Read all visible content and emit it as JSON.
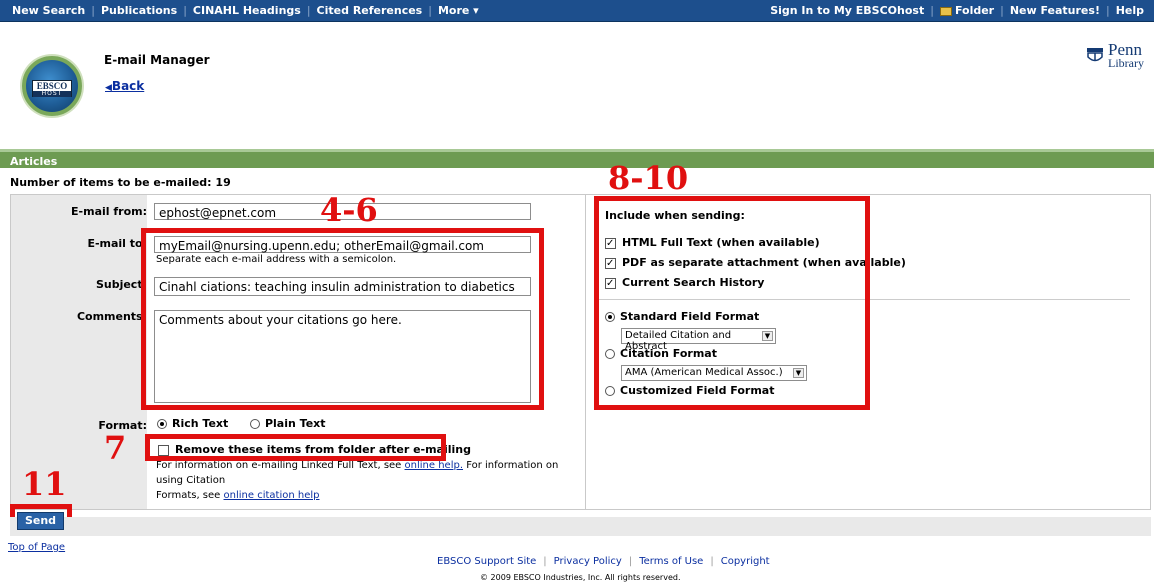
{
  "nav": {
    "left": [
      "New Search",
      "Publications",
      "CINAHL Headings",
      "Cited References",
      "More ▾"
    ],
    "sign_in": "Sign In to My EBSCOhost",
    "folder": "Folder",
    "new_features": "New Features!",
    "help": "Help"
  },
  "logo": {
    "line1": "EBSCO",
    "line2": "HOST"
  },
  "header": {
    "title": "E-mail Manager",
    "back": "Back"
  },
  "penn": {
    "line1": "Penn",
    "line2": "Library"
  },
  "section": {
    "title": "Articles",
    "count": "Number of items to be e-mailed: 19"
  },
  "form": {
    "from_label": "E-mail from:",
    "from_value": "ephost@epnet.com",
    "to_label": "E-mail to:",
    "to_value": "myEmail@nursing.upenn.edu; otherEmail@gmail.com",
    "to_hint": "Separate each e-mail address with a semicolon.",
    "subject_label": "Subject:",
    "subject_value": "Cinahl ciations: teaching insulin administration to diabetics",
    "comments_label": "Comments:",
    "comments_value": "Comments about your citations go here.",
    "format_label": "Format:",
    "format_rich": "Rich Text",
    "format_plain": "Plain Text",
    "remove_label": "Remove these items from folder after e-mailing",
    "info_part1": "For information on e-mailing Linked Full Text, see",
    "info_link1": "online help.",
    "info_part2": "For information on using Citation",
    "info_part3": "Formats, see",
    "info_link2": "online citation help"
  },
  "include": {
    "heading": "Include when sending:",
    "html_full_text": "HTML Full Text (when available)",
    "pdf_attachment": "PDF as separate attachment (when available)",
    "search_history": "Current Search History",
    "standard_format": "Standard Field Format",
    "standard_select": "Detailed Citation and Abstract",
    "citation_format": "Citation Format",
    "citation_select": "AMA (American Medical Assoc.)",
    "customized_format": "Customized Field Format"
  },
  "annotations": {
    "a1": "4-6",
    "a2": "8-10",
    "a3": "7",
    "a4": "11"
  },
  "send": "Send",
  "top_of_page": "Top of Page",
  "footer": {
    "links": [
      "EBSCO Support Site",
      "Privacy Policy",
      "Terms of Use",
      "Copyright"
    ],
    "copyright": "© 2009 EBSCO Industries, Inc. All rights reserved."
  },
  "colors": {
    "nav": "#1d4f8d",
    "section_bar": "#6d9b52",
    "annotation": "#e01010",
    "link": "#0b2fa0"
  }
}
